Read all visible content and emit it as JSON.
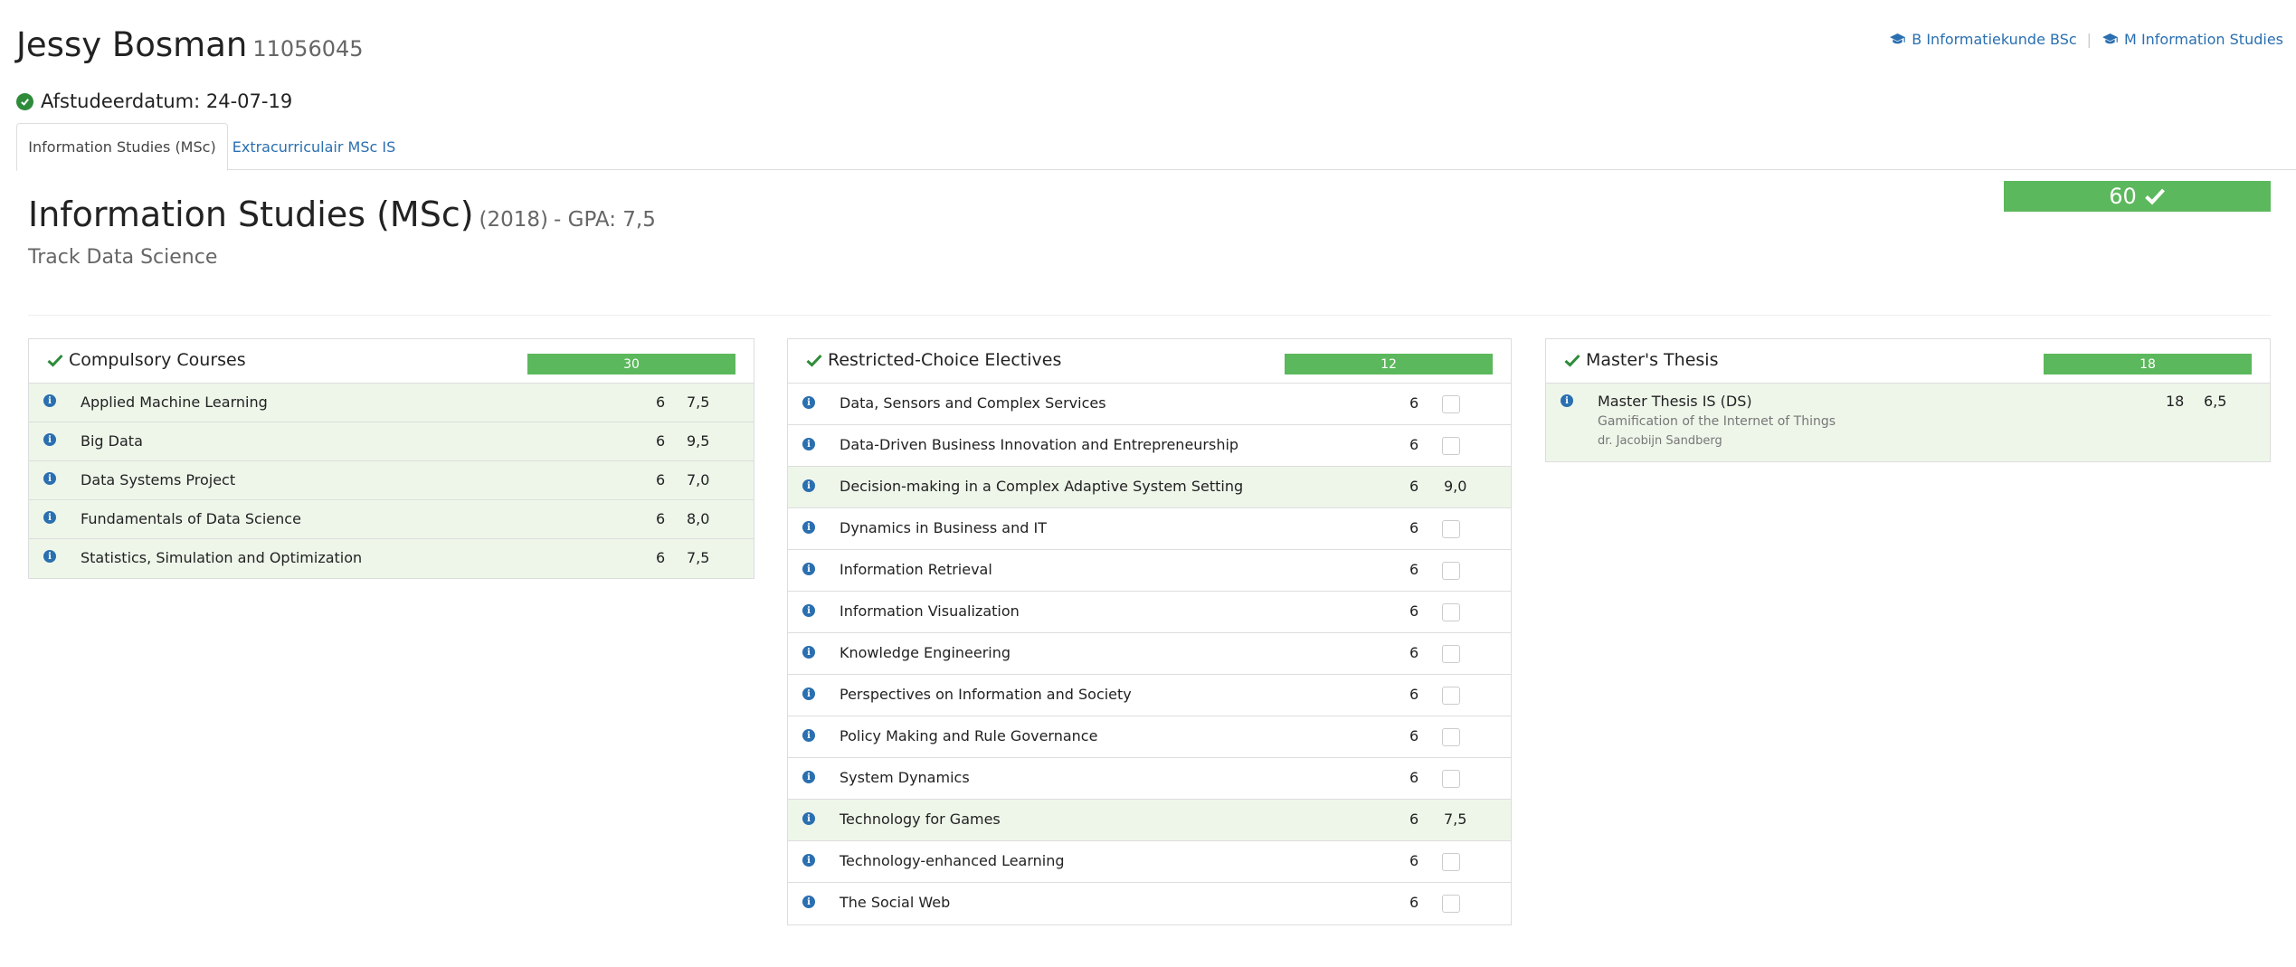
{
  "student": {
    "name": "Jessy Bosman",
    "number": "11056045",
    "graduation_date": "Afstudeerdatum: 24-07-19"
  },
  "programs": [
    {
      "label": "B Informatiekunde BSc",
      "icon": "graduation-cap-icon"
    },
    {
      "label": "M Information Studies",
      "icon": "graduation-cap-icon"
    }
  ],
  "tabs": [
    {
      "label": "Information Studies (MSc)",
      "active": true
    },
    {
      "label": "Extracurriculair MSc IS",
      "active": false
    }
  ],
  "program": {
    "title": "Information Studies (MSc)",
    "year": "(2018)",
    "gpa": "- GPA: 7,5",
    "track": "Track Data Science",
    "total_credits": "60"
  },
  "colors": {
    "progress_green": "#5cb85c",
    "passed_row": "#eef6ea",
    "link_blue": "#2a6fb0",
    "check_green": "#2e8b3a"
  },
  "panels": {
    "compulsory": {
      "title": "Compulsory Courses",
      "credits": "30",
      "courses": [
        {
          "name": "Applied Machine Learning",
          "ects": "6",
          "grade": "7,5"
        },
        {
          "name": "Big Data",
          "ects": "6",
          "grade": "9,5"
        },
        {
          "name": "Data Systems Project",
          "ects": "6",
          "grade": "7,0"
        },
        {
          "name": "Fundamentals of Data Science",
          "ects": "6",
          "grade": "8,0"
        },
        {
          "name": "Statistics, Simulation and Optimization",
          "ects": "6",
          "grade": "7,5"
        }
      ]
    },
    "electives": {
      "title": "Restricted-Choice Electives",
      "credits": "12",
      "courses": [
        {
          "name": "Data, Sensors and Complex Services",
          "ects": "6",
          "grade": ""
        },
        {
          "name": "Data-Driven Business Innovation and Entrepreneurship",
          "ects": "6",
          "grade": ""
        },
        {
          "name": "Decision-making in a Complex Adaptive System Setting",
          "ects": "6",
          "grade": "9,0"
        },
        {
          "name": "Dynamics in Business and IT",
          "ects": "6",
          "grade": ""
        },
        {
          "name": "Information Retrieval",
          "ects": "6",
          "grade": ""
        },
        {
          "name": "Information Visualization",
          "ects": "6",
          "grade": ""
        },
        {
          "name": "Knowledge Engineering",
          "ects": "6",
          "grade": ""
        },
        {
          "name": "Perspectives on Information and Society",
          "ects": "6",
          "grade": ""
        },
        {
          "name": "Policy Making and Rule Governance",
          "ects": "6",
          "grade": ""
        },
        {
          "name": "System Dynamics",
          "ects": "6",
          "grade": ""
        },
        {
          "name": "Technology for Games",
          "ects": "6",
          "grade": "7,5"
        },
        {
          "name": "Technology-enhanced Learning",
          "ects": "6",
          "grade": ""
        },
        {
          "name": "The Social Web",
          "ects": "6",
          "grade": ""
        }
      ]
    },
    "thesis": {
      "title": "Master's Thesis",
      "credits": "18",
      "courses": [
        {
          "name": "Master Thesis IS (DS)",
          "topic": "Gamification of the Internet of Things",
          "supervisor": "dr. Jacobijn Sandberg",
          "ects": "18",
          "grade": "6,5"
        }
      ]
    }
  }
}
